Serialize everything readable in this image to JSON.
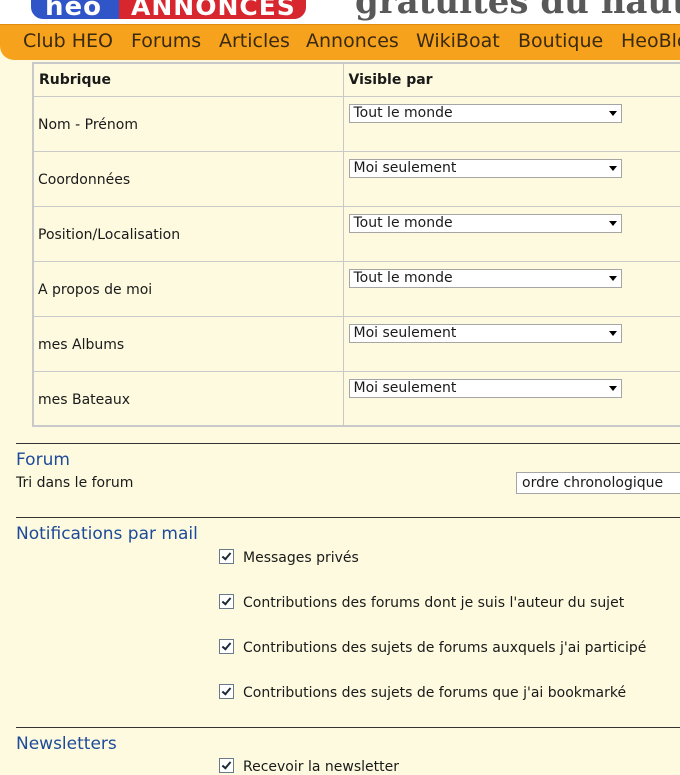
{
  "header": {
    "logo_left": "heo",
    "logo_right": "ANNONCES",
    "headline": "gratuites du nautisme",
    "nav": [
      "Club HEO",
      "Forums",
      "Articles",
      "Annonces",
      "WikiBoat",
      "Boutique",
      "HeoBlogs"
    ]
  },
  "privacy_table": {
    "col_rubrique": "Rubrique",
    "col_visible": "Visible par",
    "rows": [
      {
        "label": "Nom - Prénom",
        "value": "Tout le monde"
      },
      {
        "label": "Coordonnées",
        "value": "Moi seulement"
      },
      {
        "label": "Position/Localisation",
        "value": "Tout le monde"
      },
      {
        "label": "A propos de moi",
        "value": "Tout le monde"
      },
      {
        "label": "mes Albums",
        "value": "Moi seulement"
      },
      {
        "label": "mes Bateaux",
        "value": "Moi seulement"
      }
    ]
  },
  "forum": {
    "title": "Forum",
    "sort_label": "Tri dans le forum",
    "sort_value": "ordre chronologique"
  },
  "notifications": {
    "title": "Notifications par mail",
    "items": [
      {
        "label": "Messages privés",
        "checked": true
      },
      {
        "label": "Contributions des forums dont je suis l'auteur du sujet",
        "checked": true
      },
      {
        "label": "Contributions des sujets de forums auxquels j'ai participé",
        "checked": true
      },
      {
        "label": "Contributions des sujets de forums que j'ai bookmarké",
        "checked": true
      }
    ]
  },
  "newsletters": {
    "title": "Newsletters",
    "items": [
      {
        "label": "Recevoir la newsletter",
        "checked": true
      }
    ]
  }
}
